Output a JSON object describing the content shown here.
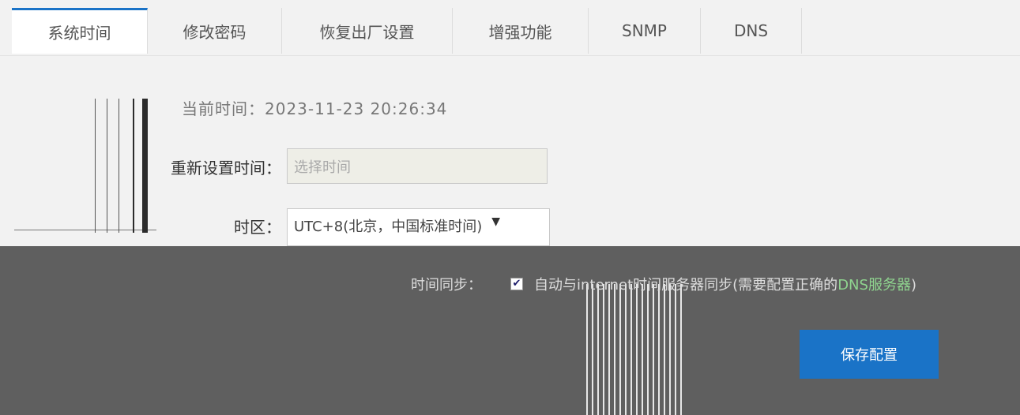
{
  "tabs": [
    {
      "label": "系统时间",
      "active": true
    },
    {
      "label": "修改密码",
      "active": false
    },
    {
      "label": "恢复出厂设置",
      "active": false
    },
    {
      "label": "增强功能",
      "active": false
    },
    {
      "label": "SNMP",
      "active": false
    },
    {
      "label": "DNS",
      "active": false
    }
  ],
  "current_time": {
    "text": "当前时间：2023-11-23 20:26:34"
  },
  "reset_time": {
    "label": "重新设置时间：",
    "placeholder": "选择时间"
  },
  "timezone": {
    "label": "时区：",
    "value": "UTC+8(北京，中国标准时间)"
  },
  "sync": {
    "label": "时间同步：",
    "checked": true,
    "text": "自动与internet时间服务器同步(需要配置正确的",
    "highlight": "DNS服务器",
    "text_after": ")"
  },
  "actions": {
    "save_label": "保存配置"
  },
  "colors": {
    "accent": "#1a73c7",
    "page_background": "#5f5f5f",
    "form_background": "#f2f2f2"
  }
}
